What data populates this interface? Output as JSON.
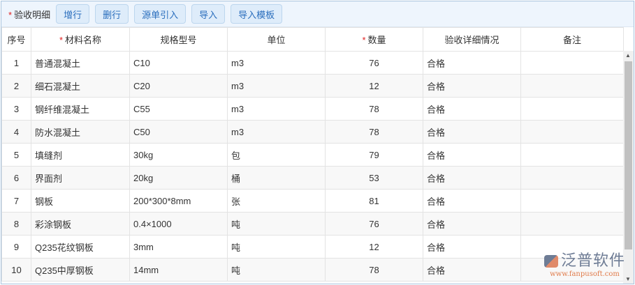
{
  "toolbar": {
    "title": "验收明细",
    "buttons": [
      "增行",
      "删行",
      "源单引入",
      "导入",
      "导入模板"
    ]
  },
  "columns": [
    "序号",
    "材料名称",
    "规格型号",
    "单位",
    "数量",
    "验收详细情况",
    "备注"
  ],
  "rows": [
    [
      "1",
      "普通混凝土",
      "C10",
      "m3",
      "76",
      "合格",
      ""
    ],
    [
      "2",
      "细石混凝土",
      "C20",
      "m3",
      "12",
      "合格",
      ""
    ],
    [
      "3",
      "钢纤维混凝土",
      "C55",
      "m3",
      "78",
      "合格",
      ""
    ],
    [
      "4",
      "防水混凝土",
      "C50",
      "m3",
      "78",
      "合格",
      ""
    ],
    [
      "5",
      "填缝剂",
      "30kg",
      "包",
      "79",
      "合格",
      ""
    ],
    [
      "6",
      "界面剂",
      "20kg",
      "桶",
      "53",
      "合格",
      ""
    ],
    [
      "7",
      "钢板",
      "200*300*8mm",
      "张",
      "81",
      "合格",
      ""
    ],
    [
      "8",
      "彩涂钢板",
      "0.4×1000",
      "吨",
      "76",
      "合格",
      ""
    ],
    [
      "9",
      "Q235花纹钢板",
      "3mm",
      "吨",
      "12",
      "合格",
      ""
    ],
    [
      "10",
      "Q235中厚钢板",
      "14mm",
      "吨",
      "78",
      "合格",
      ""
    ]
  ],
  "watermark": {
    "name": "泛普软件",
    "url": "www.fanpusoft.com"
  }
}
